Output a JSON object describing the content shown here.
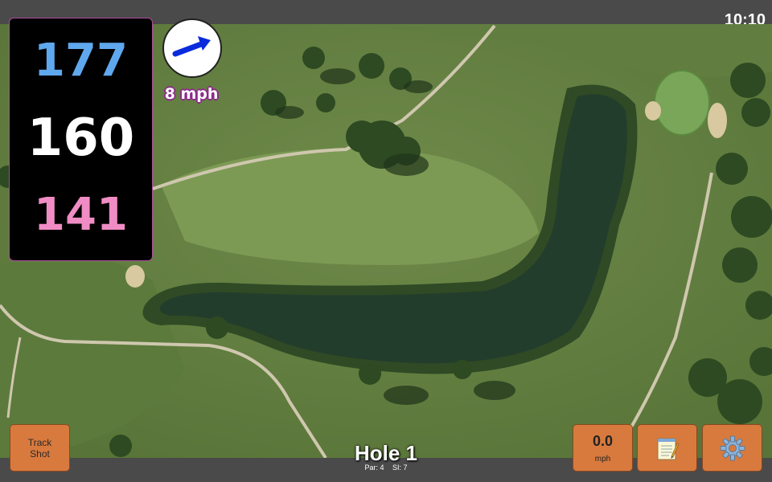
{
  "status_bar": {
    "time": "10:10"
  },
  "yardages": {
    "back": "177",
    "middle": "160",
    "front": "141"
  },
  "wind": {
    "label": "8 mph",
    "icon": "wind-direction-arrow-icon"
  },
  "buttons": {
    "track_shot_line1": "Track",
    "track_shot_line2": "Shot",
    "speed_value": "0.0",
    "speed_unit": "mph",
    "notes_icon": "notepad-icon",
    "settings_icon": "gear-icon"
  },
  "hole": {
    "title": "Hole 1",
    "par": "Par: 4",
    "si": "SI: 7"
  },
  "colors": {
    "back_yardage": "#5fa8ee",
    "middle_yardage": "#ffffff",
    "front_yardage": "#f08cc4",
    "button_orange": "#d87a3e",
    "wind_label_outline": "#8c2a8a"
  }
}
